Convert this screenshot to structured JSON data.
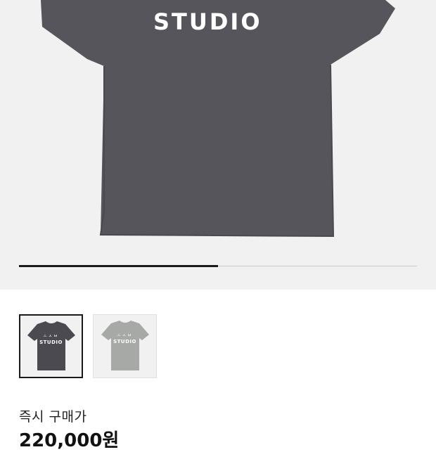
{
  "product": {
    "print_text": "STUDIO",
    "shirt_color": "#56555b",
    "alt_shirt_color": "#a7a9a6"
  },
  "gallery": {
    "progress": 0.5,
    "thumbnails": [
      {
        "print_text": "STUDIO",
        "mark": "ㅗㅅㅂ",
        "color": "#4a4a50",
        "selected": true
      },
      {
        "print_text": "STUDIO",
        "mark": "ㅗㅅㅂ",
        "color": "#a7a9a6",
        "selected": false
      }
    ]
  },
  "pricing": {
    "label": "즉시 구매가",
    "value": "220,000원"
  }
}
